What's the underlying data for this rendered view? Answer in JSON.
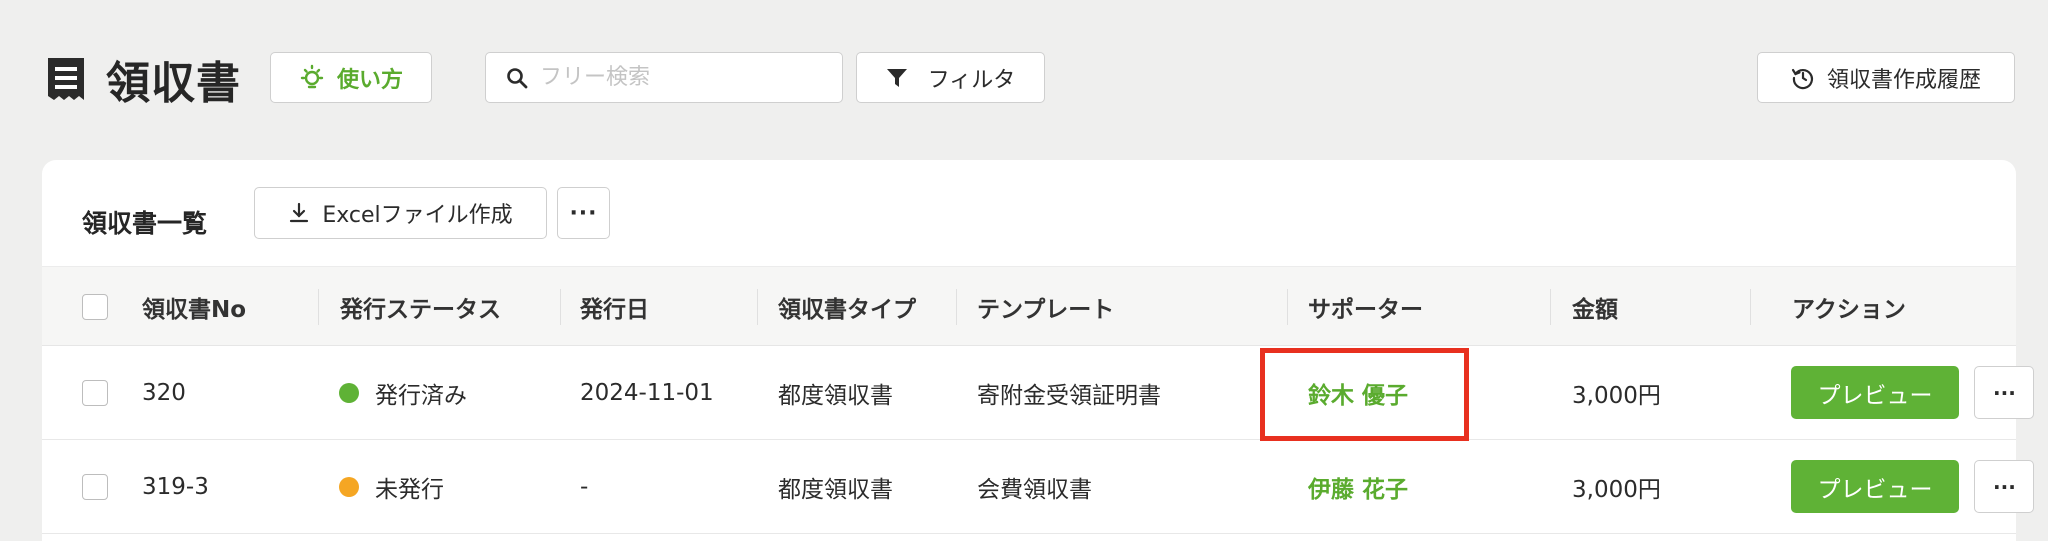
{
  "header": {
    "title": "領収書",
    "howto_label": "使い方",
    "search_placeholder": "フリー検索",
    "filter_label": "フィルタ",
    "history_label": "領収書作成履歴"
  },
  "card": {
    "title": "領収書一覧",
    "excel_label": "Excelファイル作成",
    "more_label": "···"
  },
  "table": {
    "columns": [
      "領収書No",
      "発行ステータス",
      "発行日",
      "領収書タイプ",
      "テンプレート",
      "サポーター",
      "金額",
      "アクション"
    ],
    "rows": [
      {
        "no": "320",
        "status": "発行済み",
        "status_color": "#5fb236",
        "date": "2024-11-01",
        "type": "都度領収書",
        "template": "寄附金受領証明書",
        "supporter": "鈴木 優子",
        "amount": "3,000円",
        "action_label": "プレビュー",
        "more_label": "···"
      },
      {
        "no": "319-3",
        "status": "未発行",
        "status_color": "#f5a623",
        "date": "-",
        "type": "都度領収書",
        "template": "会費領収書",
        "supporter": "伊藤 花子",
        "amount": "3,000円",
        "action_label": "プレビュー",
        "more_label": "···"
      }
    ]
  },
  "colors": {
    "accent_green": "#5fb236",
    "highlight_red": "#e8301f"
  },
  "icons": {
    "title": "receipt-icon",
    "howto": "lightbulb-icon",
    "search": "search-icon",
    "filter": "funnel-icon",
    "history": "history-icon",
    "excel": "download-icon"
  }
}
